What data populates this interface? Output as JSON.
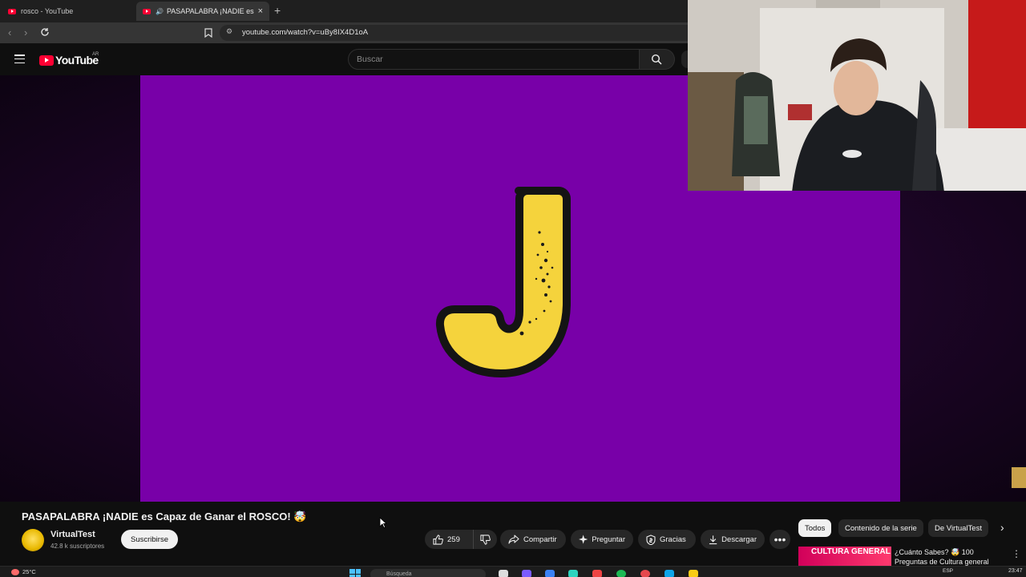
{
  "browser": {
    "tabs": [
      {
        "title": "rosco - YouTube",
        "active": false
      },
      {
        "title": "PASAPALABRA ¡NADIE es Cap",
        "active": true
      }
    ],
    "new_tab_label": "+",
    "url": "youtube.com/watch?v=uBy8IX4D1oA"
  },
  "youtube": {
    "logo_text": "YouTube",
    "region": "AR",
    "search_placeholder": "Buscar"
  },
  "video_frame": {
    "letter": "J",
    "bg_color": "#7800a8",
    "letter_color": "#f5d33c"
  },
  "video": {
    "title": "PASAPALABRA ¡NADIE es Capaz de Ganar el ROSCO! 🤯",
    "channel": "VirtualTest",
    "subscribers": "42.8 k suscriptores",
    "subscribe_label": "Suscribirse",
    "likes": "259",
    "share_label": "Compartir",
    "ask_label": "Preguntar",
    "thanks_label": "Gracias",
    "download_label": "Descargar",
    "more_label": "•••"
  },
  "recommendations": {
    "chips": [
      "Todos",
      "Contenido de la serie",
      "De VirtualTest"
    ],
    "next_label": "›",
    "first": {
      "thumb_text": "CULTURA GENERAL",
      "title": "¿Cuánto Sabes? 🤯 100 Preguntas de Cultura general"
    }
  },
  "taskbar": {
    "weather": "25°C",
    "search_placeholder": "Búsqueda",
    "language": "ESP",
    "time": "23:47"
  }
}
